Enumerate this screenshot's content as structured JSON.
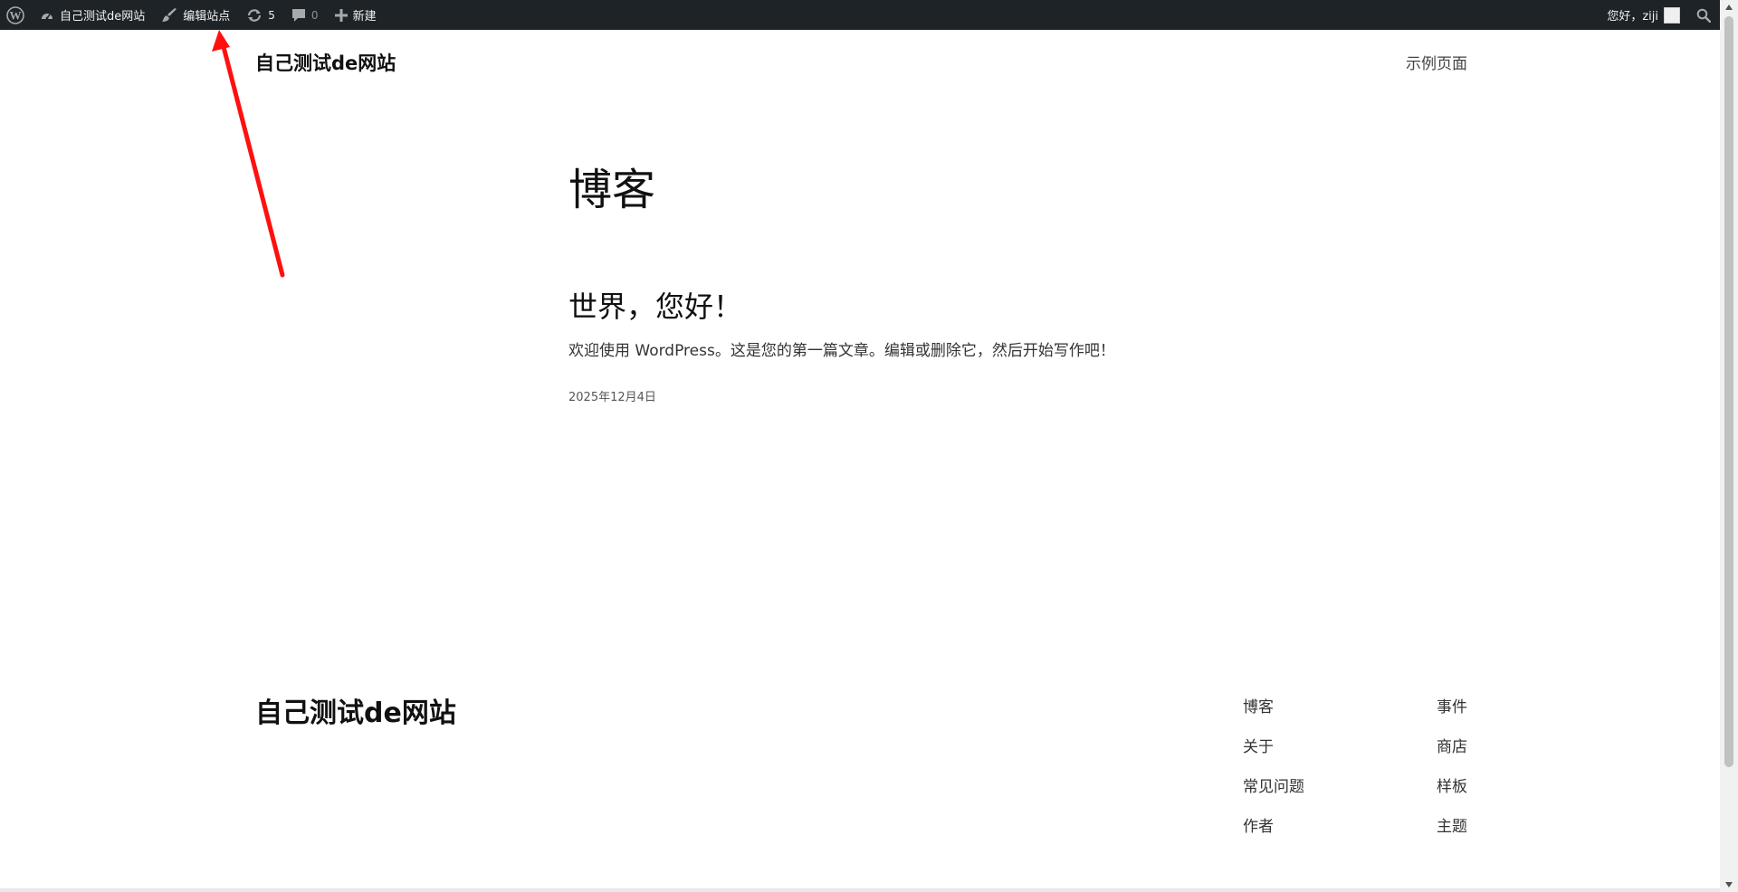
{
  "admin_bar": {
    "site_name": "自己测试de网站",
    "edit_site": "编辑站点",
    "updates_count": "5",
    "comments_count": "0",
    "new_label": "新建",
    "greeting": "您好，ziji",
    "icons": {
      "logo": "wordpress-logo-icon",
      "dashboard": "dashboard-icon",
      "edit": "brush-icon",
      "updates": "updates-icon",
      "comments": "comment-icon",
      "new": "plus-icon",
      "search": "search-icon"
    }
  },
  "header": {
    "site_title": "自己测试de网站",
    "nav_item": "示例页面"
  },
  "main": {
    "page_title": "博客",
    "post": {
      "title": "世界，您好！",
      "excerpt": "欢迎使用 WordPress。这是您的第一篇文章。编辑或删除它，然后开始写作吧！",
      "date": "2025年12月4日"
    }
  },
  "footer": {
    "site_title": "自己测试de网站",
    "col1": [
      "博客",
      "关于",
      "常见问题",
      "作者"
    ],
    "col2": [
      "事件",
      "商店",
      "样板",
      "主题"
    ]
  },
  "colors": {
    "admin_bar_bg": "#1d2327",
    "annotation_arrow": "#ff1010"
  }
}
